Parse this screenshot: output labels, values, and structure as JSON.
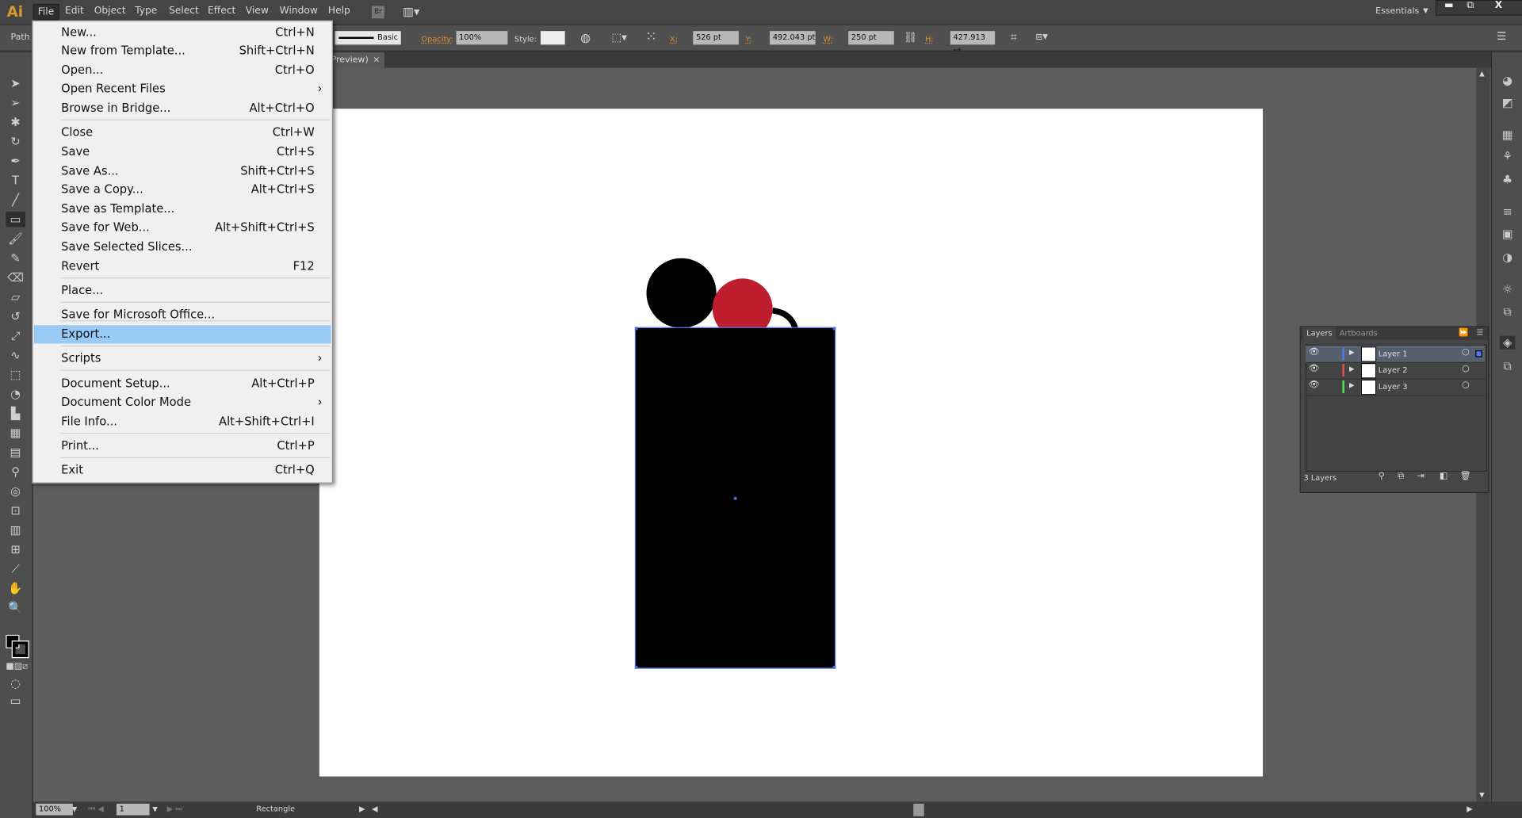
{
  "app": {
    "logo": "Ai",
    "workspace": "Essentials",
    "window_controls": [
      "minimize",
      "restore",
      "close"
    ]
  },
  "menubar": [
    "File",
    "Edit",
    "Object",
    "Type",
    "Select",
    "Effect",
    "View",
    "Window",
    "Help"
  ],
  "bridge_label": "Br",
  "control_bar": {
    "selection_type": "Path",
    "stroke_style": "Basic",
    "opacity_label": "Opacity:",
    "opacity": "100%",
    "style_label": "Style:",
    "x_label": "X:",
    "x": "526 pt",
    "y_label": "Y:",
    "y": "492.043 pt",
    "w_label": "W:",
    "w": "250 pt",
    "h_label": "H:",
    "h": "427.913 pt"
  },
  "doc_tab": {
    "title": "Preview)",
    "close": "×"
  },
  "file_menu": [
    {
      "label": "New...",
      "shortcut": "Ctrl+N"
    },
    {
      "label": "New from Template...",
      "shortcut": "Shift+Ctrl+N"
    },
    {
      "label": "Open...",
      "shortcut": "Ctrl+O"
    },
    {
      "label": "Open Recent Files",
      "submenu": true
    },
    {
      "label": "Browse in Bridge...",
      "shortcut": "Alt+Ctrl+O"
    },
    {
      "label": "Close",
      "shortcut": "Ctrl+W"
    },
    {
      "label": "Save",
      "shortcut": "Ctrl+S"
    },
    {
      "label": "Save As...",
      "shortcut": "Shift+Ctrl+S"
    },
    {
      "label": "Save a Copy...",
      "shortcut": "Alt+Ctrl+S"
    },
    {
      "label": "Save as Template..."
    },
    {
      "label": "Save for Web...",
      "shortcut": "Alt+Shift+Ctrl+S"
    },
    {
      "label": "Save Selected Slices..."
    },
    {
      "label": "Revert",
      "shortcut": "F12"
    },
    {
      "label": "Place..."
    },
    {
      "label": "Save for Microsoft Office..."
    },
    {
      "label": "Export...",
      "highlighted": true
    },
    {
      "label": "Scripts",
      "submenu": true
    },
    {
      "label": "Document Setup...",
      "shortcut": "Alt+Ctrl+P"
    },
    {
      "label": "Document Color Mode",
      "submenu": true
    },
    {
      "label": "File Info...",
      "shortcut": "Alt+Shift+Ctrl+I"
    },
    {
      "label": "Print...",
      "shortcut": "Ctrl+P"
    },
    {
      "label": "Exit",
      "shortcut": "Ctrl+Q"
    }
  ],
  "layers_panel": {
    "tabs": [
      "Layers",
      "Artboards"
    ],
    "layers": [
      {
        "name": "Layer 1",
        "color": "#4f7ae8"
      },
      {
        "name": "Layer 2",
        "color": "#e84f4f"
      },
      {
        "name": "Layer 3",
        "color": "#4fe84f"
      }
    ],
    "count": "3 Layers"
  },
  "status": {
    "zoom": "100%",
    "artboard": "1",
    "tool": "Rectangle"
  },
  "colors": {
    "red_circle": "#be1e2d",
    "selection": "#4a6fe0",
    "highlight": "#99c9f5"
  }
}
